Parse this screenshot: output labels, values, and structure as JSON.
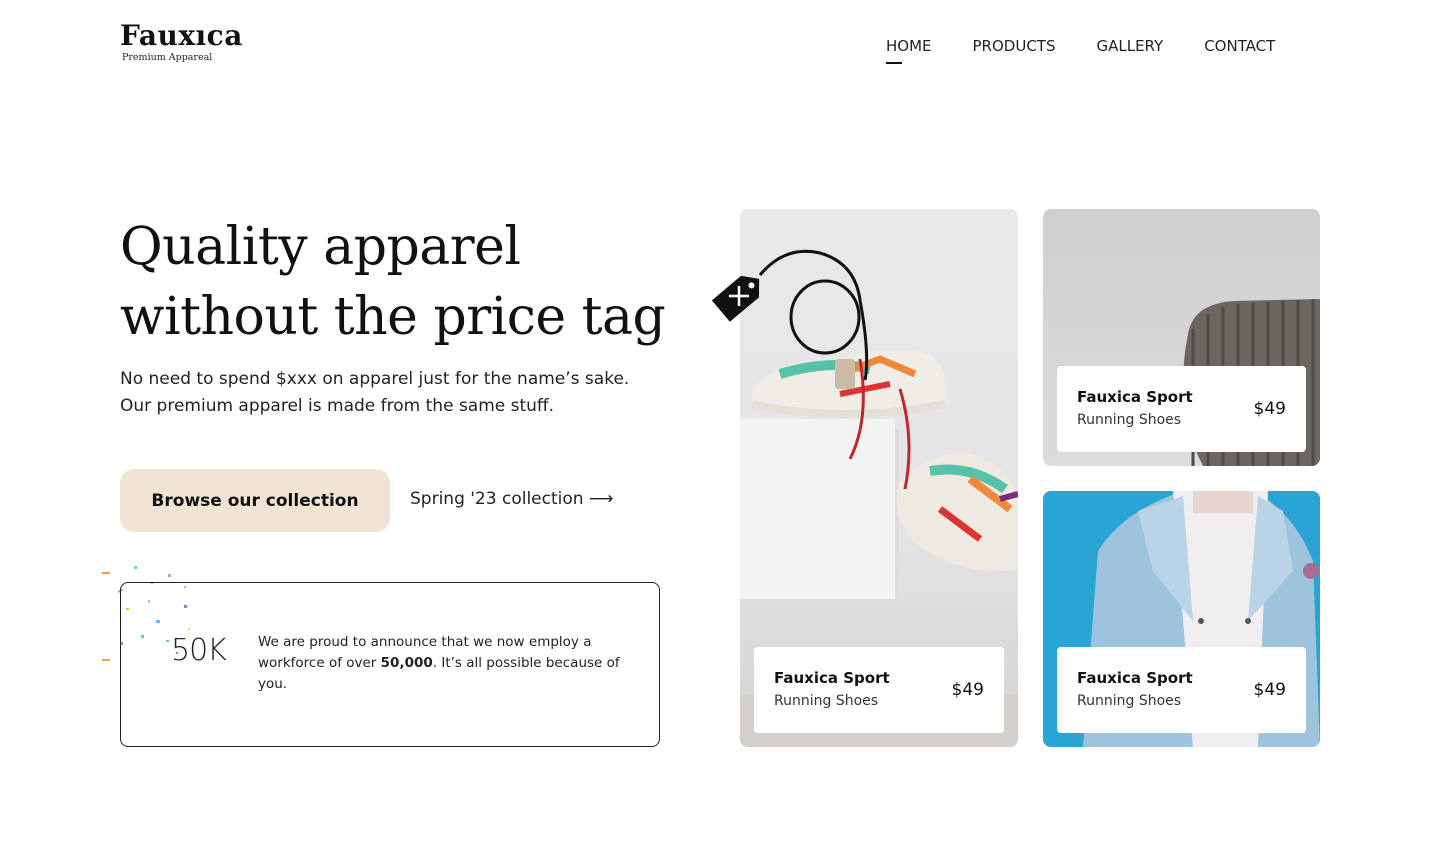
{
  "brand": {
    "name": "Fauxıca",
    "tagline": "Premium Appareal"
  },
  "nav": [
    {
      "label": "HOME",
      "active": true
    },
    {
      "label": "PRODUCTS",
      "active": false
    },
    {
      "label": "GALLERY",
      "active": false
    },
    {
      "label": "CONTACT",
      "active": false
    }
  ],
  "hero": {
    "title_line1": "Quality apparel",
    "title_line2": "without the price tag",
    "sub_line1": "No need to spend $xxx on apparel just for the name’s sake.",
    "sub_line2": "Our premium apparel is made from the same stuff.",
    "cta_label": "Browse our collection",
    "link_label": "Spring '23 collection ⟶"
  },
  "announce": {
    "number": "50K",
    "text_before": "We are proud to announce that we now employ a workforce of over ",
    "text_bold": "50,000",
    "text_after": ". It’s all possible because of you."
  },
  "cards": [
    {
      "title": "Fauxica Sport",
      "subtitle": "Running Shoes",
      "price": "$49"
    },
    {
      "title": "Fauxica Sport",
      "subtitle": "Running Shoes",
      "price": "$49"
    },
    {
      "title": "Fauxica Sport",
      "subtitle": "Running Shoes",
      "price": "$49"
    }
  ],
  "colors": {
    "cta_bg": "#f2e4d5",
    "jacket_bg": "#2aa4d4",
    "text": "#111111"
  }
}
